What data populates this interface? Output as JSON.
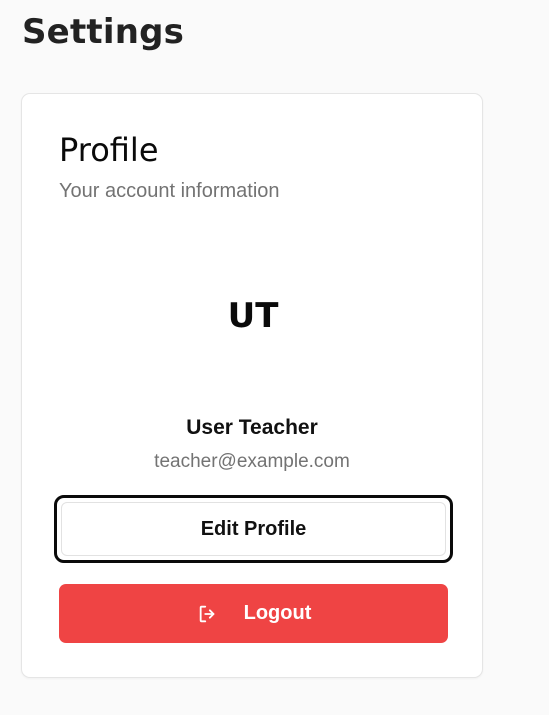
{
  "page": {
    "title": "Settings"
  },
  "profile_card": {
    "title": "Profile",
    "subtitle": "Your account information",
    "avatar_initials": "UT",
    "user_name": "User Teacher",
    "user_email": "teacher@example.com",
    "edit_button_label": "Edit Profile",
    "logout_button_label": "Logout",
    "logout_icon": "log-out-icon"
  },
  "colors": {
    "logout_background": "#ef4444",
    "page_background": "#fafafa",
    "card_background": "#ffffff",
    "muted_text": "#737373"
  }
}
